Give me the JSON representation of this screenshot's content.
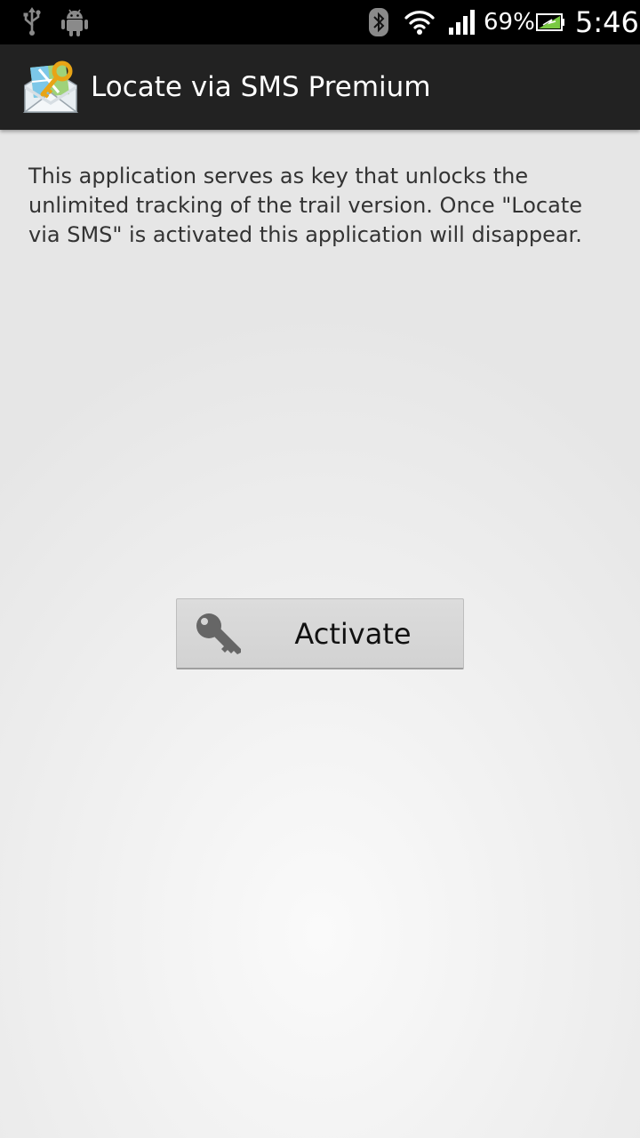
{
  "status_bar": {
    "icons": [
      "usb-icon",
      "android-icon",
      "bluetooth-icon",
      "wifi-icon",
      "signal-icon",
      "battery-charging-icon"
    ],
    "battery_percent": "69%",
    "time": "5:46"
  },
  "action_bar": {
    "icon": "app-icon-envelope-key",
    "title": "Locate via SMS Premium"
  },
  "main": {
    "description": "This application serves as key that unlocks the unlimited tracking of the trail version. Once \"Locate via SMS\" is activated this application will disappear.",
    "activate_button": {
      "icon": "key-icon",
      "label": "Activate"
    }
  },
  "colors": {
    "status_bar_bg": "#000000",
    "action_bar_bg": "#222222",
    "battery_green": "#7ac943",
    "button_bg": "#d6d6d6"
  }
}
